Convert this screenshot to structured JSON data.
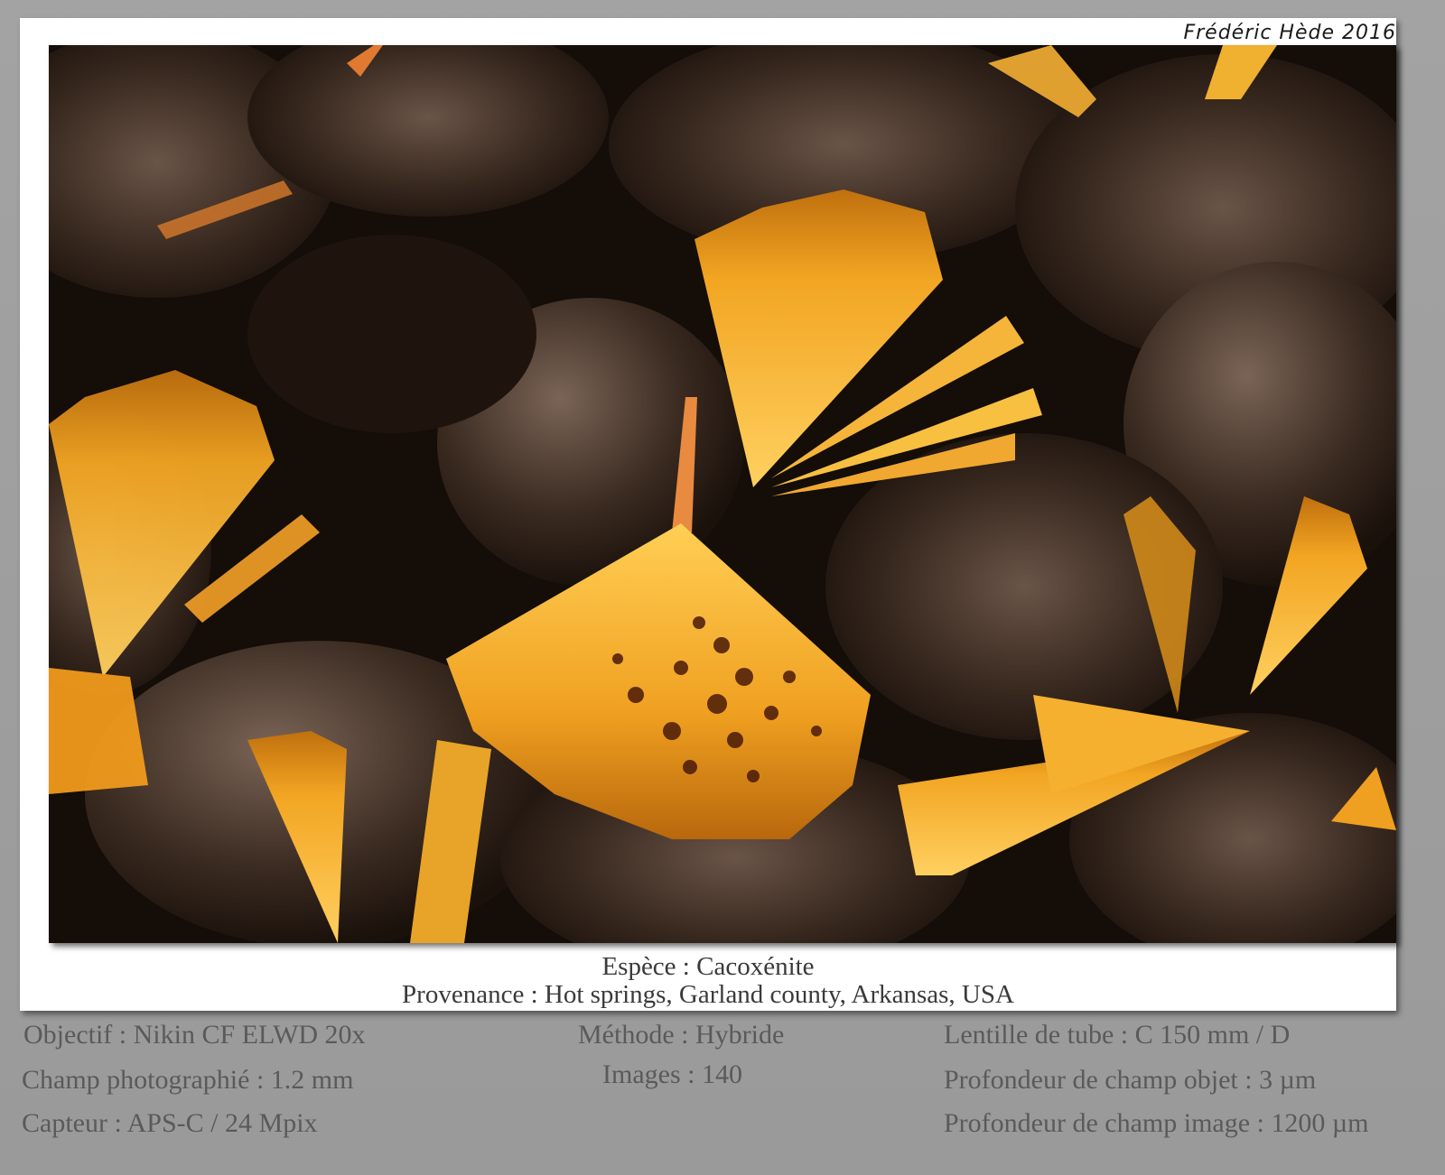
{
  "signature": "Frédéric Hède 2016",
  "caption": {
    "species": "Espèce : Cacoxénite",
    "origin": "Provenance : Hot springs, Garland county, Arkansas, USA"
  },
  "specs": {
    "objective": "Objectif : Nikin CF ELWD 20x",
    "field": "Champ photographié : 1.2 mm",
    "sensor": "Capteur : APS-C / 24 Mpix",
    "method": "Méthode : Hybride",
    "images": "Images : 140",
    "tube_lens": "Lentille de tube : C 150 mm / D",
    "object_dof": "Profondeur de champ objet : 3 µm",
    "image_dof": "Profondeur de champ image : 1200 µm"
  },
  "colors": {
    "crystal": "#f0a020",
    "crystal_light": "#ffd060",
    "matrix": "#2a1d14",
    "background": "#8f8f8f"
  }
}
